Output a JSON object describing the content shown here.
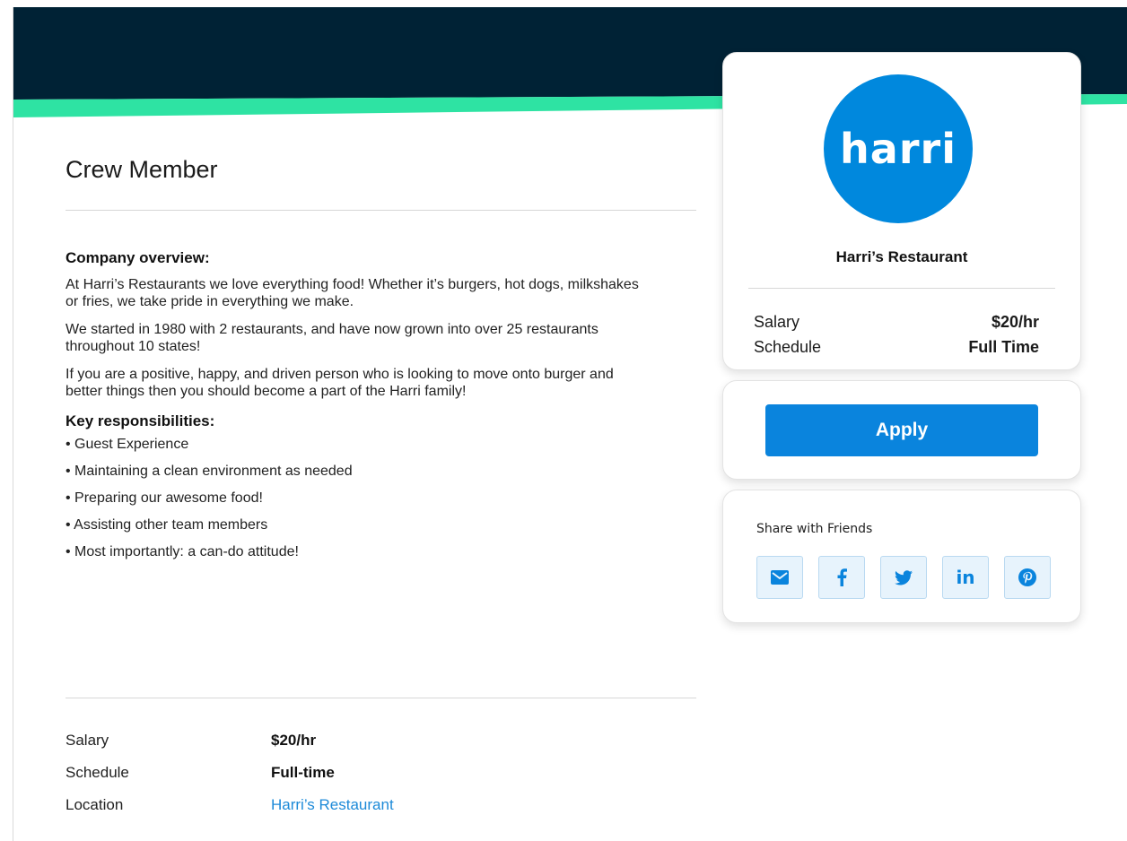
{
  "colors": {
    "header_dark": "#002235",
    "header_accent": "#2ee3a3",
    "brand_blue": "#0088dd",
    "link_blue": "#1d8ad8"
  },
  "job": {
    "title": "Crew Member",
    "company_overview_heading": "Company overview:",
    "overview_paragraphs": [
      "At Harri’s Restaurants we love everything food! Whether it’s burgers, hot dogs, milkshakes or fries, we take pride in everything we make.",
      "We started in 1980 with 2 restaurants, and have now grown into over 25 restaurants throughout 10 states!",
      "If you are a positive, happy, and driven person who is looking to move onto burger and better things then you should become a part of the Harri family!"
    ],
    "responsibilities_heading": "Key responsibilities:",
    "responsibilities": [
      "• Guest Experience",
      "• Maintaining a clean environment as needed",
      "• Preparing our awesome food!",
      "• Assisting other team members",
      "• Most importantly: a can-do attitude!"
    ],
    "facts": {
      "salary_label": "Salary",
      "salary_value": "$20/hr",
      "schedule_label": "Schedule",
      "schedule_value": "Full-time",
      "location_label": "Location",
      "location_value": "Harri’s Restaurant"
    }
  },
  "company_card": {
    "logo_text": "harri",
    "company_name": "Harri’s Restaurant",
    "salary_label": "Salary",
    "salary_value": "$20/hr",
    "schedule_label": "Schedule",
    "schedule_value": "Full Time"
  },
  "apply_card": {
    "apply_label": "Apply"
  },
  "share_card": {
    "label": "Share with Friends",
    "icons": [
      "email-icon",
      "facebook-icon",
      "twitter-icon",
      "linkedin-icon",
      "pinterest-icon"
    ],
    "linkedin_text": "in"
  }
}
